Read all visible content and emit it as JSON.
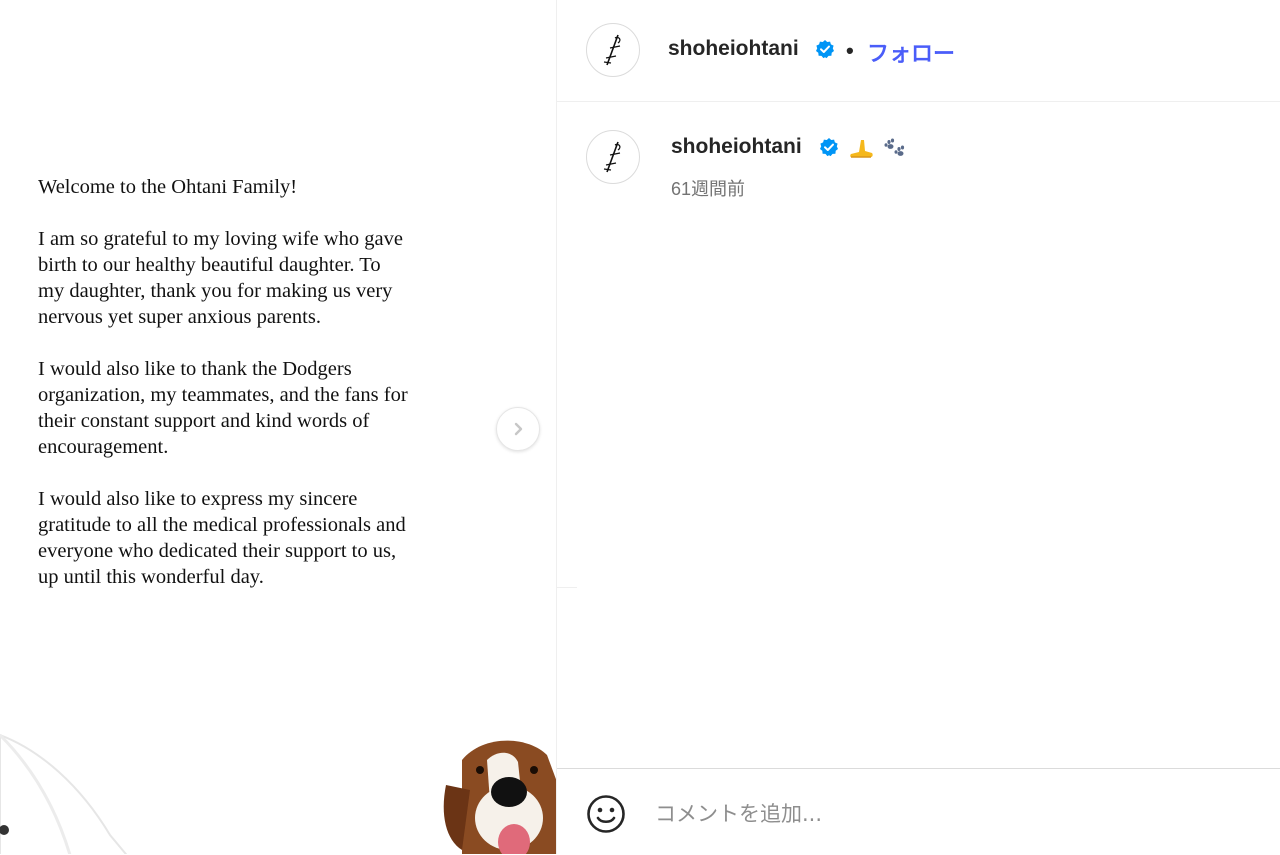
{
  "post": {
    "paragraphs": [
      "Welcome to the Ohtani Family!",
      "I am so grateful to my loving wife who gave birth to our healthy beautiful daughter. To my daughter, thank you for making us very nervous yet super anxious parents.",
      "I would also like to thank the Dodgers organization, my teammates, and the fans for their constant support and kind words of encouragement.",
      "I would also like to express my sincere gratitude to all the medical professionals and everyone who dedicated their support to us, up until this wonderful day."
    ]
  },
  "header": {
    "username": "shoheiohtani",
    "separator": "•",
    "follow_label": "フォロー"
  },
  "caption": {
    "username": "shoheiohtani",
    "timestamp": "61週間前"
  },
  "comment": {
    "placeholder": "コメントを追加..."
  },
  "colors": {
    "follow": "#4a5df9",
    "verified": "#0095f6",
    "muted": "#737373"
  }
}
